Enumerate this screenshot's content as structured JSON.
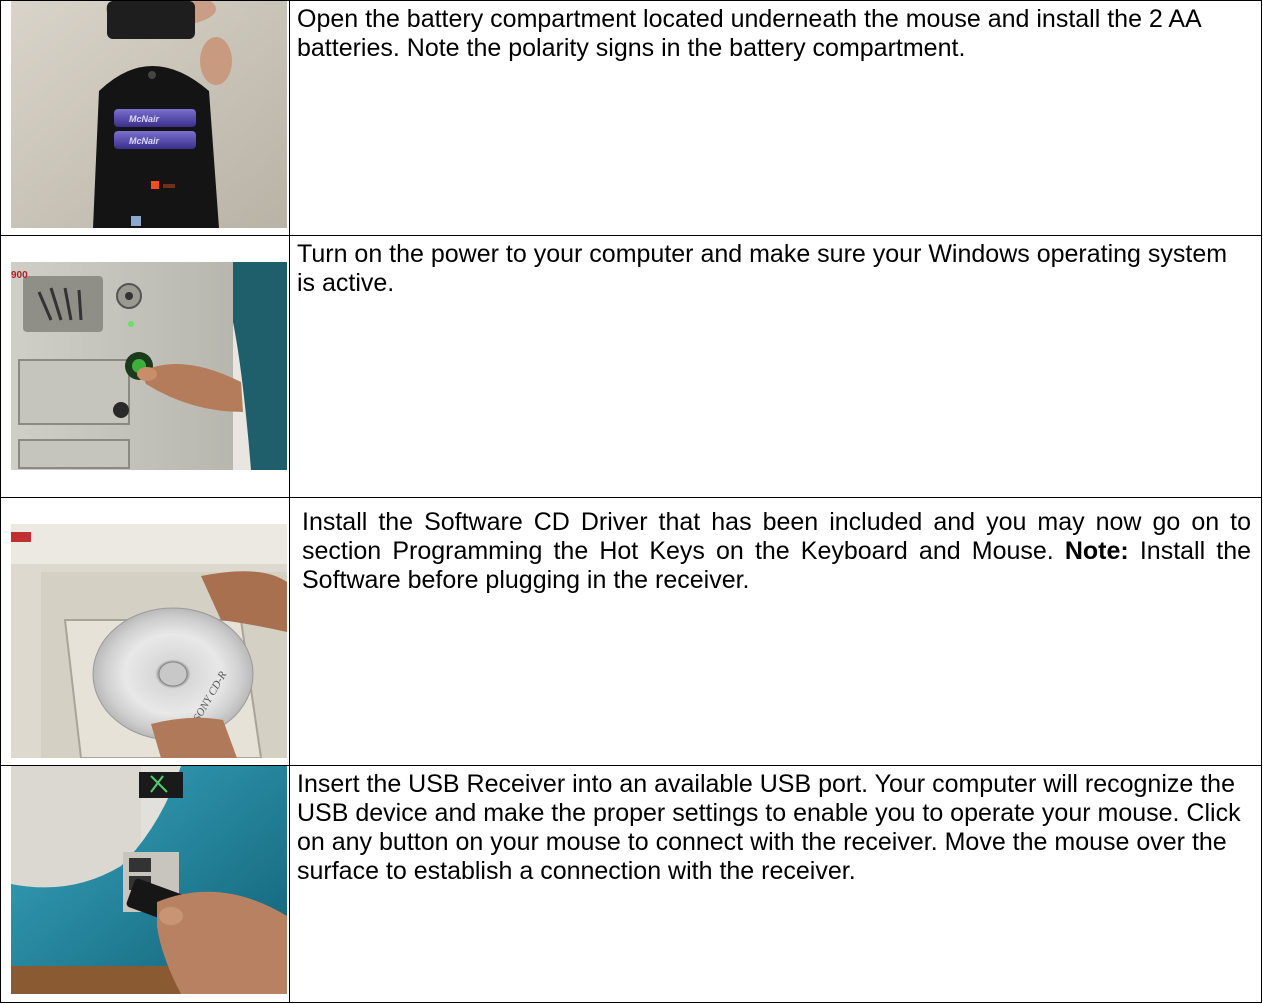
{
  "steps": [
    {
      "text": "Open the battery compartment located underneath the mouse and install the 2 AA batteries. Note the polarity signs in the battery compartment.",
      "photo_icon": "battery-photo-icon",
      "battery_brand": "McNair"
    },
    {
      "text": "Turn on the power to your computer and make sure your Windows operating system is active.",
      "photo_icon": "power-button-photo-icon",
      "case_label": "900"
    },
    {
      "text": "Install the Software CD Driver that has been included and you may now go on to section Programming the Hot Keys on the Keyboard and Mouse. ",
      "note_label": "Note:",
      "note_text": " Install the Software before plugging in the receiver.",
      "photo_icon": "cd-drive-photo-icon",
      "cd_label": "SONY CD-R"
    },
    {
      "text": "Insert the USB Receiver into an available USB port. Your computer will recognize the USB device and make the proper settings to enable you to operate your mouse. Click on any button on your mouse to connect with the receiver. Move the mouse over the surface to establish a connection with the receiver.",
      "photo_icon": "usb-receiver-photo-icon"
    }
  ]
}
